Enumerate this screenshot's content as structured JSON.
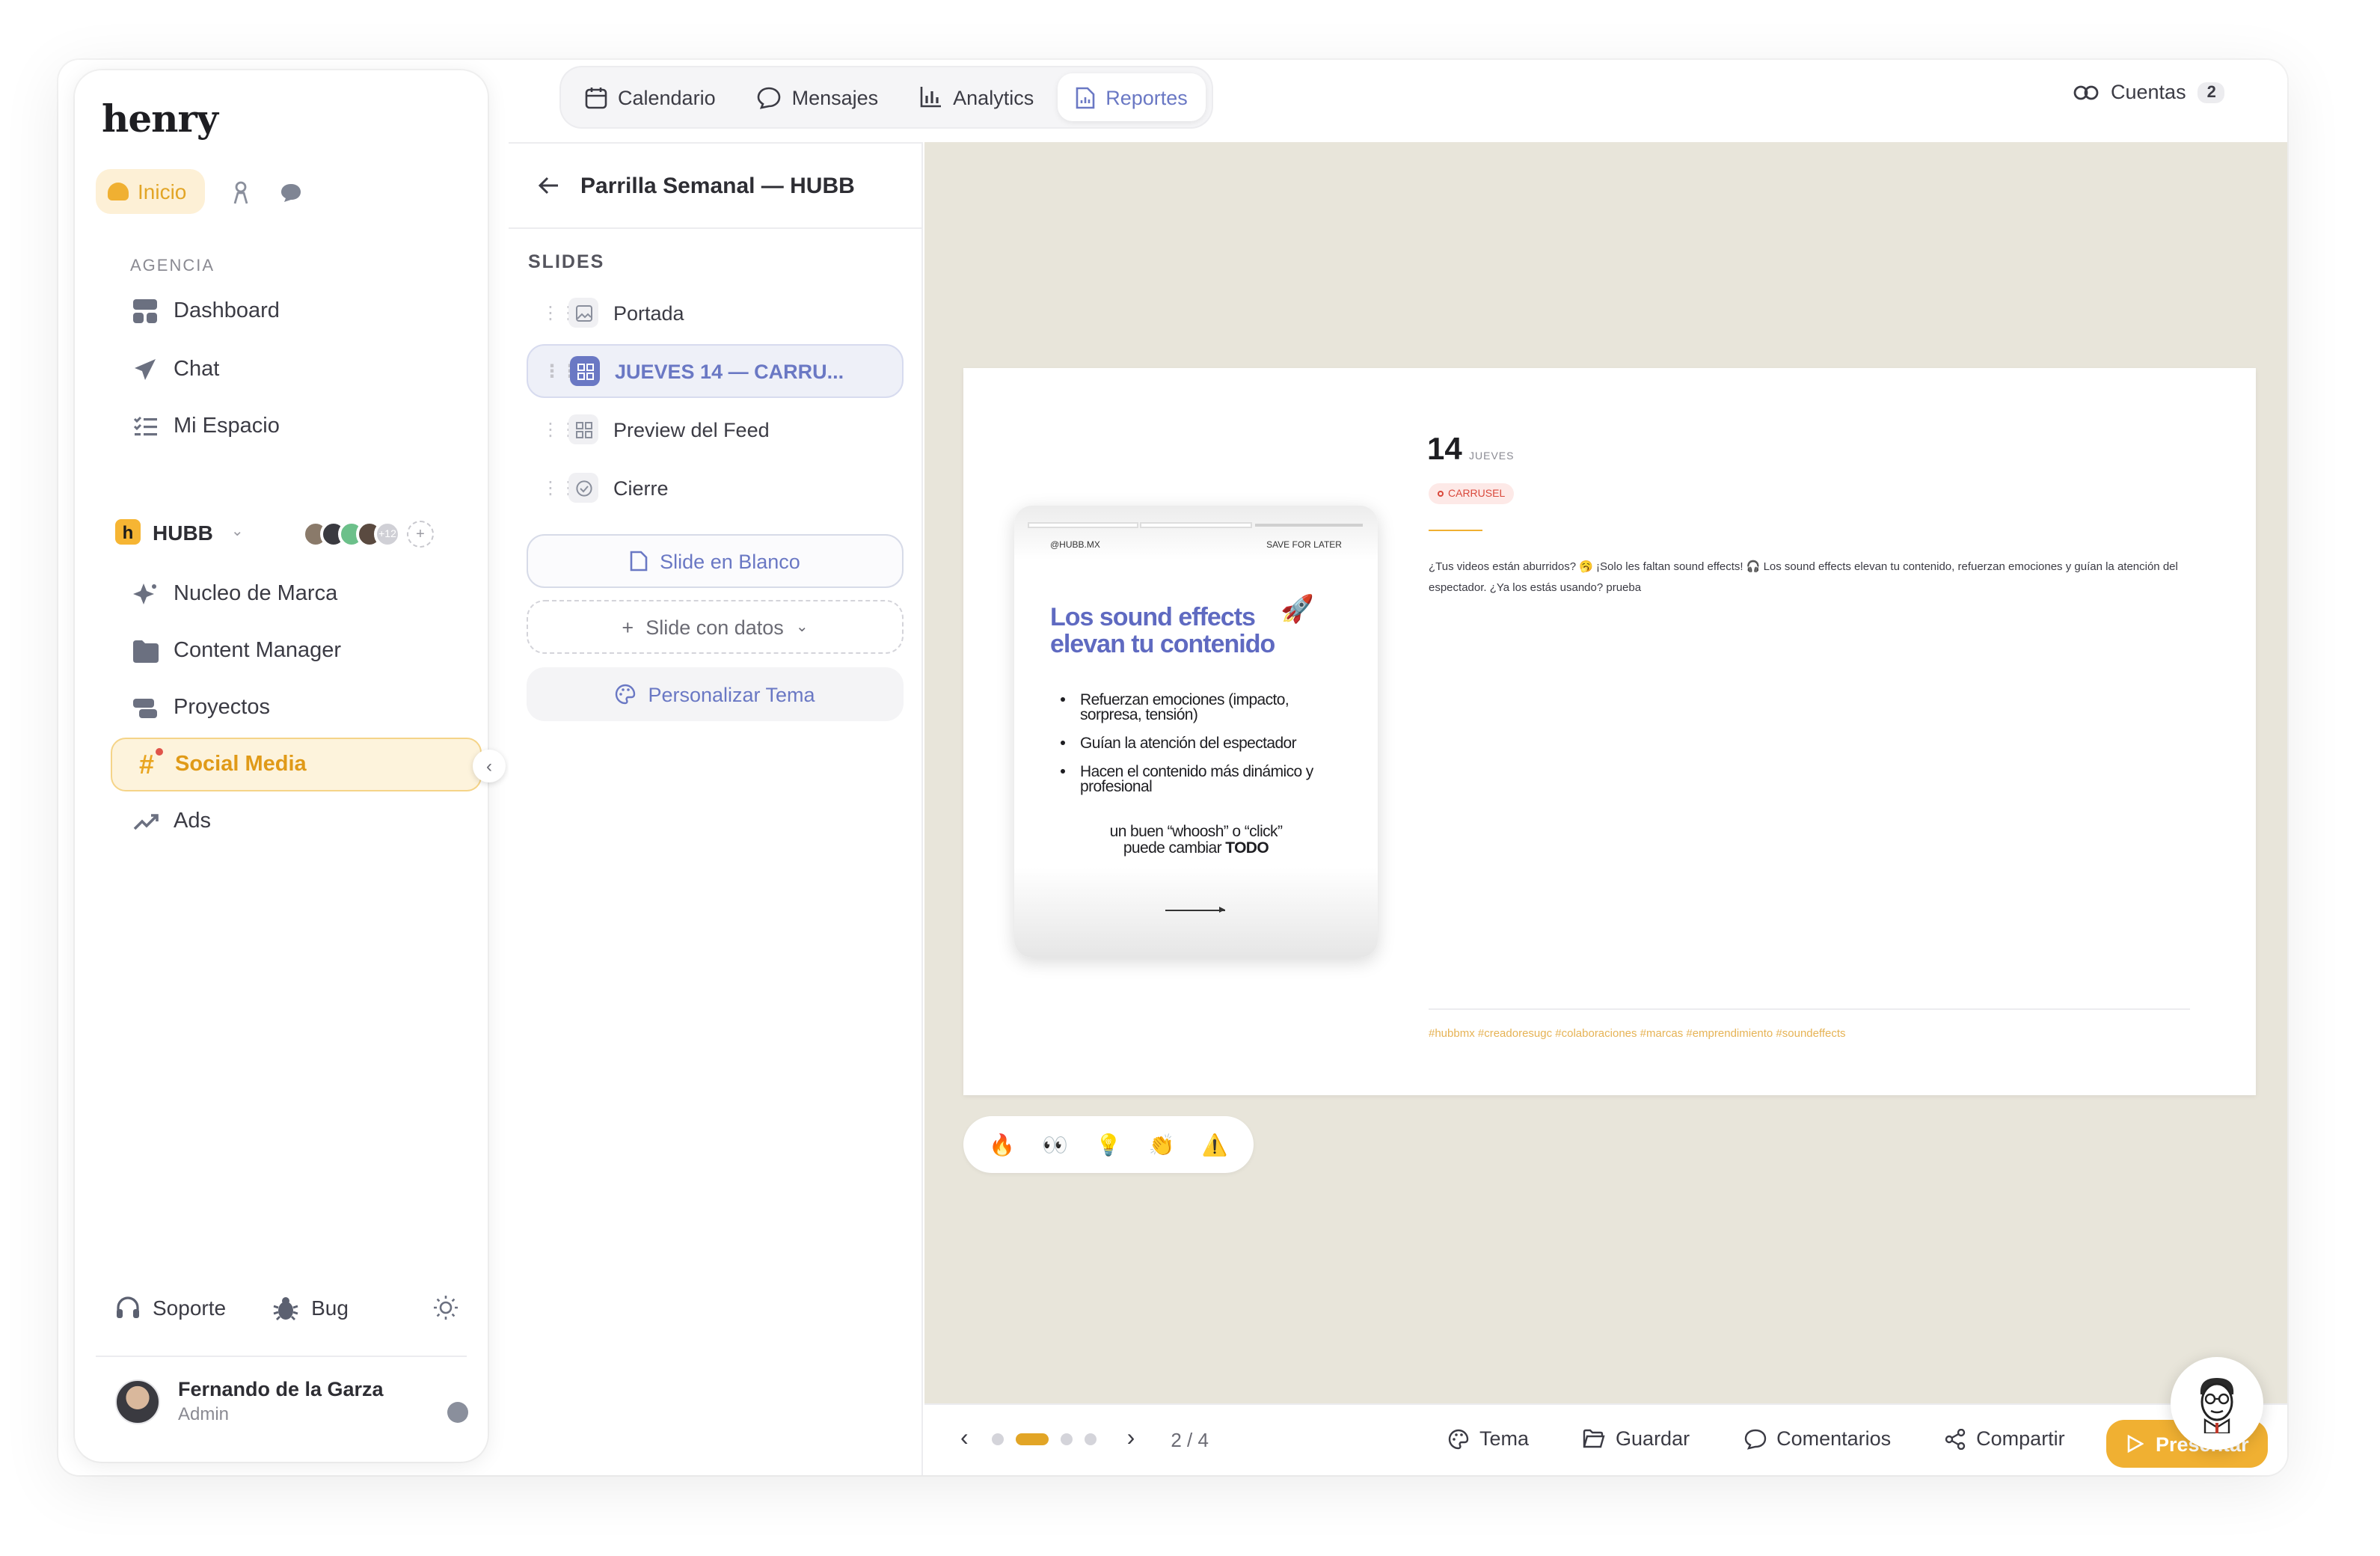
{
  "app": {
    "logo": "henry"
  },
  "sidebar": {
    "inicio_label": "Inicio",
    "section_label": "AGENCIA",
    "items": [
      {
        "label": "Dashboard",
        "icon": "dashboard-icon"
      },
      {
        "label": "Chat",
        "icon": "send-icon"
      },
      {
        "label": "Mi Espacio",
        "icon": "checklist-icon"
      }
    ],
    "workspace": {
      "name": "HUBB",
      "logo_letter": "h",
      "members_more": "+12"
    },
    "workspace_items": [
      {
        "label": "Nucleo de Marca",
        "icon": "sparkle-icon"
      },
      {
        "label": "Content Manager",
        "icon": "folder-icon"
      },
      {
        "label": "Proyectos",
        "icon": "projects-icon"
      },
      {
        "label": "Social Media",
        "icon": "hashtag-icon",
        "active": true
      },
      {
        "label": "Ads",
        "icon": "trend-icon"
      }
    ],
    "support_label": "Soporte",
    "bug_label": "Bug",
    "user": {
      "name": "Fernando de la Garza",
      "role": "Admin"
    }
  },
  "topnav": {
    "tabs": [
      {
        "label": "Calendario",
        "icon": "calendar-icon"
      },
      {
        "label": "Mensajes",
        "icon": "message-icon"
      },
      {
        "label": "Analytics",
        "icon": "bar-chart-icon"
      },
      {
        "label": "Reportes",
        "icon": "report-icon",
        "active": true
      }
    ],
    "accounts_label": "Cuentas",
    "accounts_count": "2"
  },
  "panel": {
    "title": "Parrilla Semanal — HUBB",
    "slides_label": "SLIDES",
    "slides": [
      {
        "label": "Portada"
      },
      {
        "label": "JUEVES 14 — CARRU...",
        "active": true
      },
      {
        "label": "Preview del Feed"
      },
      {
        "label": "Cierre"
      }
    ],
    "blank_slide_label": "Slide en Blanco",
    "data_slide_label": "Slide con datos",
    "theme_label": "Personalizar Tema"
  },
  "slide": {
    "post": {
      "handle": "@HUBB.MX",
      "save": "SAVE FOR LATER",
      "headline_1": "Los sound effects",
      "headline_2": "elevan tu contenido",
      "bullets": [
        "Refuerzan emociones (impacto, sorpresa, tensión)",
        "Guían la atención del espectador",
        "Hacen el contenido más dinámico y profesional"
      ],
      "footer_1": "un buen “whoosh” o “click”",
      "footer_2": "puede cambiar",
      "footer_bold": "TODO"
    },
    "day_number": "14",
    "day_name": "JUEVES",
    "tag": "CARRUSEL",
    "caption": "¿Tus videos están aburridos? 🥱 ¡Solo les faltan sound effects! 🎧 Los sound effects elevan tu contenido, refuerzan emociones y guían la atención del espectador. ¿Ya los estás usando? prueba",
    "hashtags": "#hubbmx #creadoresugc #colaboraciones #marcas #emprendimiento #soundeffects",
    "reactions": [
      "🔥",
      "👀",
      "💡",
      "👏",
      "⚠️"
    ]
  },
  "bottombar": {
    "page_indicator": "2 / 4",
    "current_page": 2,
    "total_pages": 4,
    "theme_label": "Tema",
    "save_label": "Guardar",
    "comments_label": "Comentarios",
    "share_label": "Compartir",
    "present_label": "Presentar"
  },
  "colors": {
    "accent": "#f0b032",
    "primary": "#6a78c4",
    "canvas_bg": "#e8e5da",
    "tag_red": "#d9483b"
  }
}
